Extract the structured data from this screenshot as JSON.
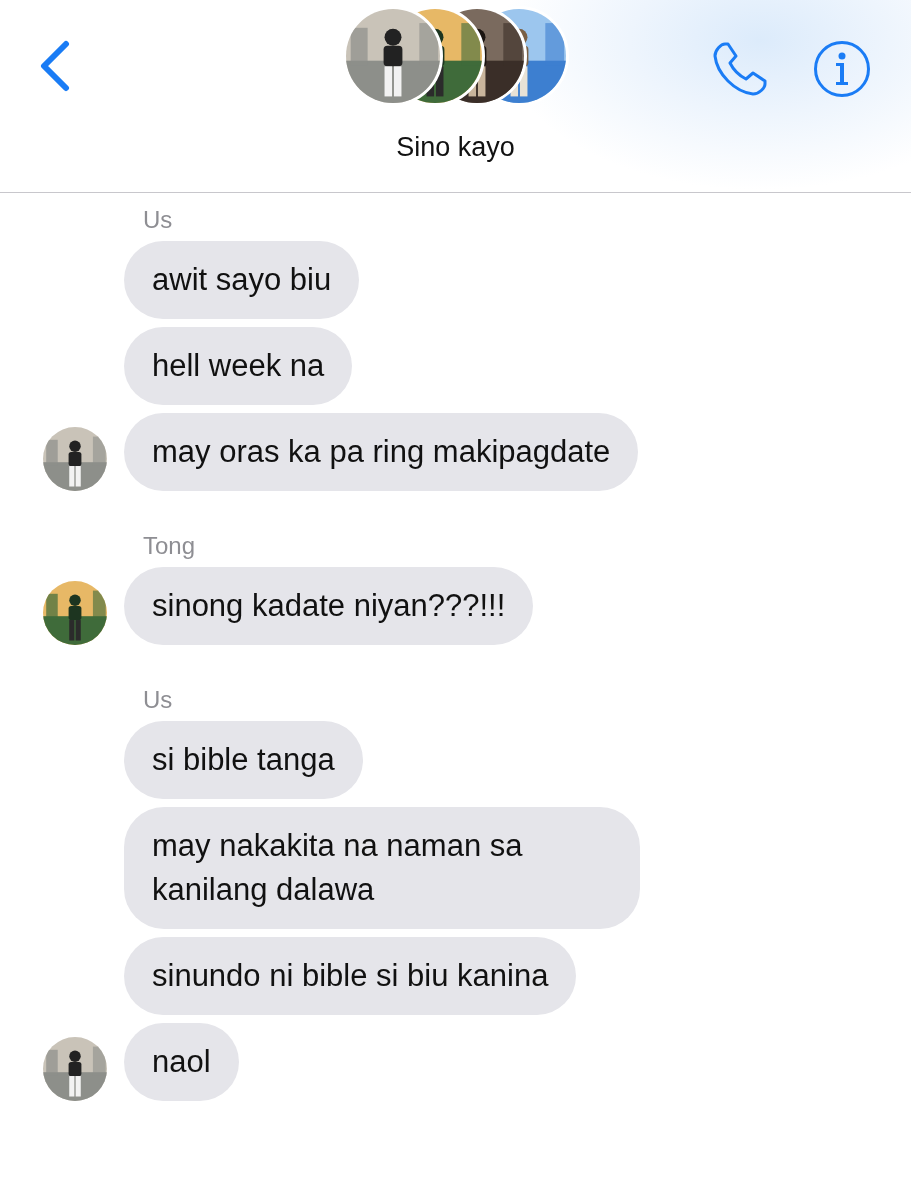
{
  "header": {
    "title": "Sino kayo"
  },
  "groups": [
    {
      "sender": "Us",
      "messages": [
        {
          "text": "awit sayo biu"
        },
        {
          "text": "hell week na"
        },
        {
          "text": "may oras ka pa ring makipagdate"
        }
      ]
    },
    {
      "sender": "Tong",
      "messages": [
        {
          "text": "sinong kadate niyan???!!!"
        }
      ]
    },
    {
      "sender": "Us",
      "messages": [
        {
          "text": "si bible tanga"
        },
        {
          "text": "may nakakita na naman sa kanilang dalawa"
        },
        {
          "text": "sinundo ni bible si biu kanina"
        },
        {
          "text": "naol"
        }
      ]
    }
  ]
}
